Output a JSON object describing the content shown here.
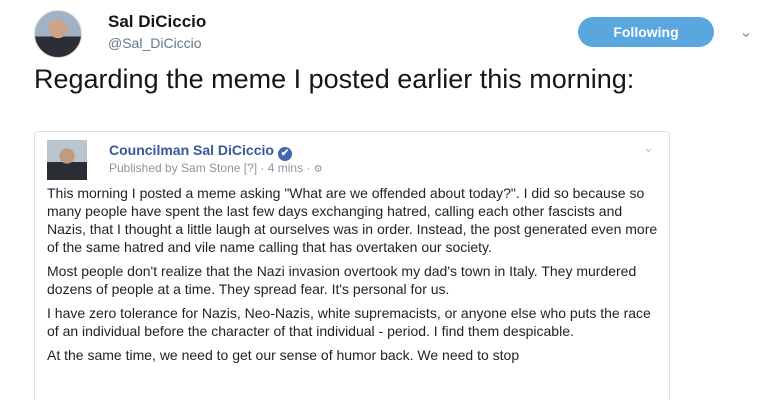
{
  "header": {
    "name": "Sal DiCiccio",
    "handle": "@Sal_DiCiccio",
    "follow_label": "Following",
    "caret_icon": "chevron-down-icon"
  },
  "tweet": {
    "text": "Regarding the meme I posted earlier this morning:"
  },
  "embedded_post": {
    "page_name": "Councilman Sal DiCiccio",
    "verified_icon": "✔",
    "meta": "Published by Sam Stone [?] · 4 mins · ",
    "globe_icon": "🌐",
    "paragraphs": [
      "This morning I posted a meme asking \"What are we offended about today?\". I did so because so many people have spent the last few days exchanging hatred, calling each other fascists and Nazis, that I thought a little laugh at ourselves was in order. Instead, the post generated even more of the same hatred and vile name calling that has overtaken our society.",
      "Most people don't realize that the Nazi invasion overtook my dad's town in Italy. They murdered dozens of people at a time. They spread fear. It's personal for us.",
      "I have zero tolerance for Nazis, Neo-Nazis, white supremacists, or anyone else who puts the race of an individual before the character of that individual - period. I find them despicable.",
      "At the same time, we need to get our sense of humor back. We need to stop"
    ]
  }
}
